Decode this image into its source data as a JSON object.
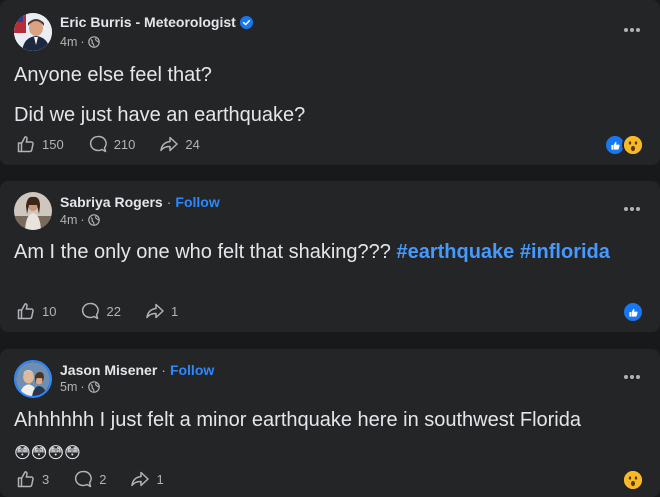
{
  "posts": [
    {
      "author": "Eric Burris - Meteorologist",
      "verified": true,
      "follow_label": "",
      "time": "4m",
      "dot": "·",
      "lines": [
        "Anyone else feel that?",
        "Did we just have an earthquake?"
      ],
      "hashtags": [],
      "likes": "150",
      "comments": "210",
      "shares": "24",
      "reactions": [
        "like-icon",
        "wow-icon"
      ]
    },
    {
      "author": "Sabriya Rogers",
      "verified": false,
      "follow_label": "Follow",
      "time": "4m",
      "dot": "·",
      "text": "Am I the only one who felt that shaking???",
      "hashtags": [
        "#earthquake",
        "#inflorida"
      ],
      "likes": "10",
      "comments": "22",
      "shares": "1",
      "reactions": [
        "like-icon"
      ]
    },
    {
      "author": "Jason Misener",
      "verified": false,
      "follow_label": "Follow",
      "time": "5m",
      "dot": "·",
      "text": "Ahhhhhh I just felt a minor earthquake here in southwest Florida",
      "emoji": "😳😳😳😳",
      "likes": "3",
      "comments": "2",
      "shares": "1",
      "reactions": [
        "wow-icon"
      ]
    }
  ],
  "colors": {
    "background": "#18191a",
    "card": "#242526",
    "text": "#e4e6eb",
    "secondary": "#b0b3b8",
    "link": "#2d88ff",
    "like": "#1877f2",
    "wow": "#f7b928"
  }
}
